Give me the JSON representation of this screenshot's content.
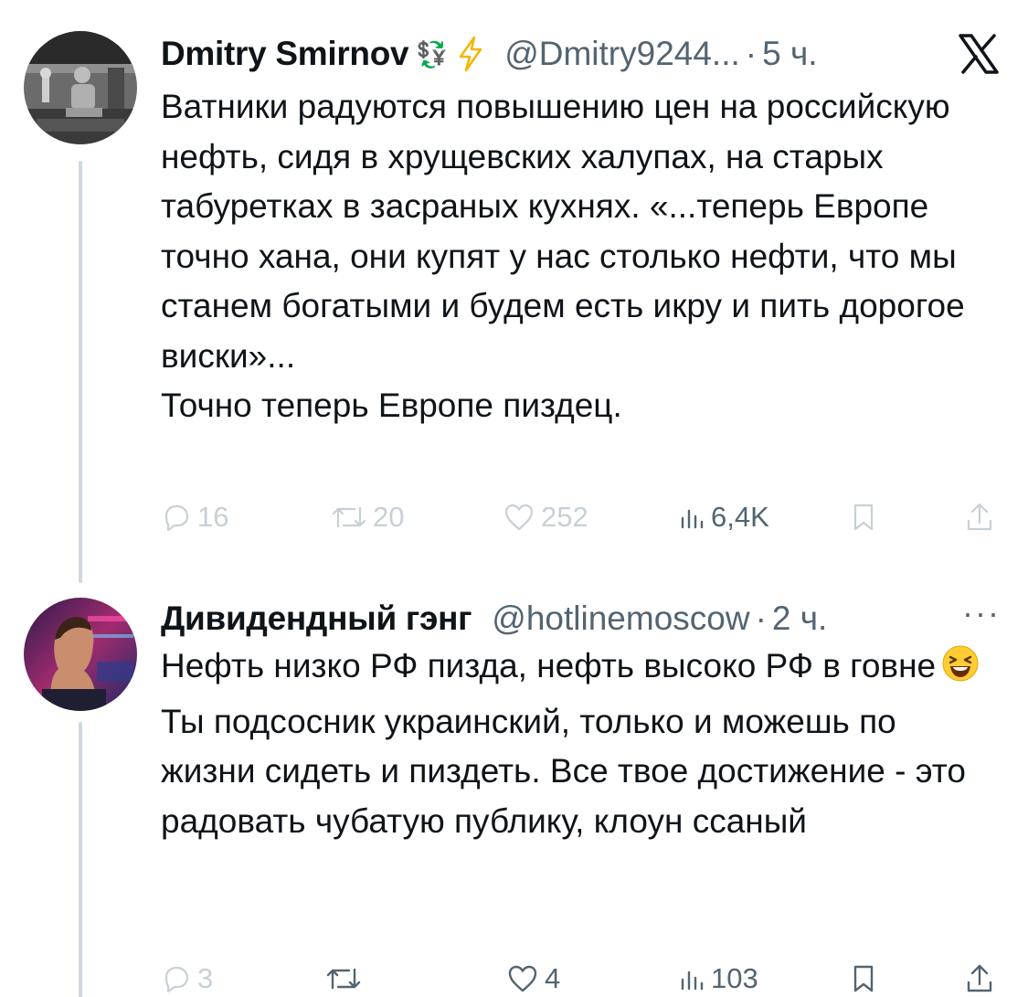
{
  "tweets": [
    {
      "author_name": "Dmitry Smirnov",
      "name_emoji": "💱",
      "handle": "@Dmitry9244...",
      "separator": "·",
      "time": "5 ч.",
      "paragraphs": [
        "Ватники радуются повышению цен на российскую нефть, сидя в хрущевских халупах, на старых табуретках в засраных кухнях. «...теперь Европе точно хана, они купят у нас столько нефти, что мы станем богатыми и будем есть икру и пить дорогое виски»...",
        "Точно теперь Европе пиздец."
      ],
      "actions": {
        "replies": "16",
        "retweets": "20",
        "likes": "252",
        "views": "6,4K"
      }
    },
    {
      "author_name": "Дивидендный гэнг",
      "handle": "@hotlinemoscow",
      "separator": "·",
      "time": "2 ч.",
      "more": "···",
      "paragraph1": "Нефть низко РФ пизда, нефть высоко РФ в говне",
      "paragraph2": "Ты подсосник украинский, только и можешь по жизни сидеть и пиздеть. Все твое достижение - это радовать чубатую публику, клоун ссаный",
      "actions": {
        "replies": "3",
        "retweets": "",
        "likes": "4",
        "views": "103"
      }
    }
  ],
  "colors": {
    "text": "#0f1419",
    "secondary": "#536471",
    "faded": "#aab8c2",
    "thread_line": "#cfd9de",
    "lightning": "#f4b400"
  },
  "icons": {
    "x_logo": "x-logo-icon",
    "lightning": "lightning-icon",
    "reply": "reply-icon",
    "retweet": "retweet-icon",
    "like": "heart-icon",
    "views": "views-icon",
    "bookmark": "bookmark-icon",
    "share": "share-icon",
    "more": "more-icon"
  }
}
